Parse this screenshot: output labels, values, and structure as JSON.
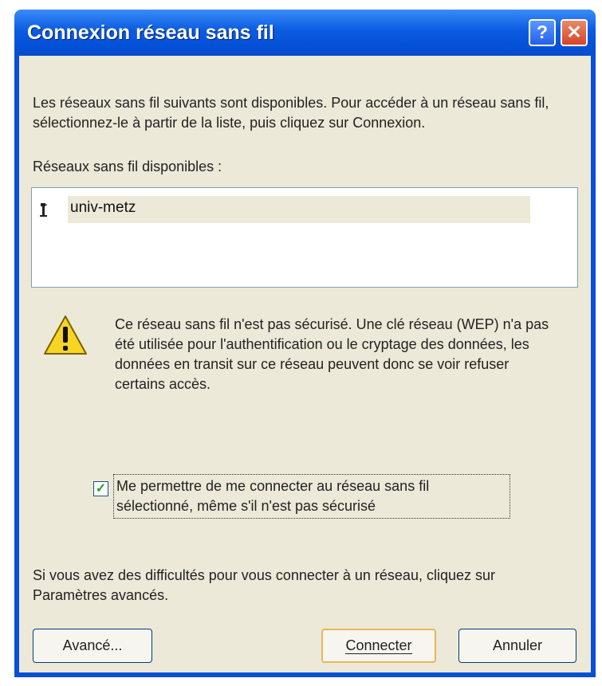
{
  "window": {
    "title": "Connexion réseau sans fil",
    "help_button": "?",
    "close_button": "✕"
  },
  "intro_text": "Les réseaux sans fil suivants sont disponibles. Pour accéder à un réseau sans fil, sélectionnez-le à partir de la liste, puis cliquez sur Connexion.",
  "networks_label": "Réseaux sans fil disponibles :",
  "networks": [
    {
      "name": "univ-metz",
      "icon": "wireless-antenna-icon",
      "selected": true
    }
  ],
  "warning": {
    "icon": "warning-icon",
    "text": "Ce réseau sans fil n'est pas sécurisé. Une clé réseau (WEP) n'a pas été utilisée pour l'authentification ou le cryptage des données, les données en transit sur ce réseau peuvent donc se voir refuser certains accès."
  },
  "allow_checkbox": {
    "checked": true,
    "label": "Me permettre de me connecter au réseau sans fil sélectionné, même s'il n'est pas sécurisé"
  },
  "help_text": "Si vous avez des difficultés pour vous connecter à un réseau, cliquez sur Paramètres avancés.",
  "buttons": {
    "advanced": "Avancé...",
    "connect": "Connecter",
    "cancel": "Annuler"
  },
  "colors": {
    "titlebar": "#0b5ce1",
    "dialog_bg": "#ece9d8",
    "close_button": "#d3442a",
    "warning_yellow": "#f8d524"
  }
}
